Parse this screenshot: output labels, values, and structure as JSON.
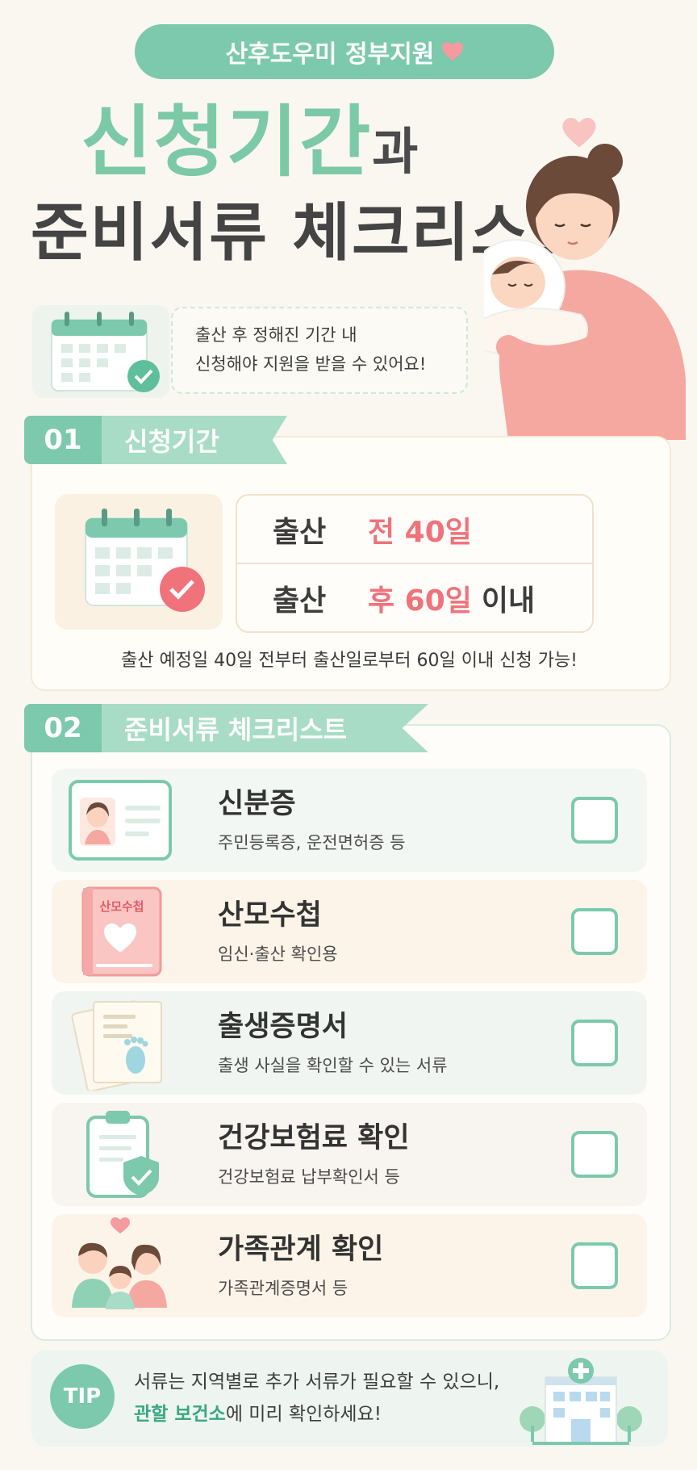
{
  "header": {
    "pill_text": "산후도우미 정부지원",
    "title_main": "신청기간",
    "title_suffix": "과",
    "title_line2": "준비서류 체크리스트"
  },
  "intro": {
    "line1": "출산 후 정해진 기간 내",
    "line2": "신청해야 지원을 받을 수 있어요!"
  },
  "section1": {
    "number": "01",
    "label": "신청기간",
    "rows": [
      {
        "label": "출산",
        "accent": "전 40일",
        "tail": ""
      },
      {
        "label": "출산",
        "accent": "후 60일",
        "tail": "이내"
      }
    ],
    "note": "출산 예정일 40일 전부터 출산일로부터 60일 이내 신청 가능!"
  },
  "section2": {
    "number": "02",
    "label": "준비서류 체크리스트",
    "items": [
      {
        "title": "신분증",
        "sub": "주민등록증, 운전면허증 등",
        "icon": "id-card-icon",
        "checked": false
      },
      {
        "title": "산모수첩",
        "sub": "임신·출산 확인용",
        "icon": "maternity-handbook-icon",
        "book_label": "산모수첩",
        "checked": false
      },
      {
        "title": "출생증명서",
        "sub": "출생 사실을 확인할 수 있는 서류",
        "icon": "birth-certificate-icon",
        "checked": false
      },
      {
        "title": "건강보험료 확인",
        "sub": "건강보험료 납부확인서 등",
        "icon": "insurance-clipboard-icon",
        "checked": false
      },
      {
        "title": "가족관계 확인",
        "sub": "가족관계증명서  등",
        "icon": "family-icon",
        "checked": false
      }
    ]
  },
  "tip": {
    "badge": "TIP",
    "line1": "서류는 지역별로 추가 서류가 필요할 수 있으니,",
    "line2_highlight": "관할 보건소",
    "line2_rest": "에 미리 확인하세요!"
  },
  "colors": {
    "mint": "#7cc9ad",
    "mint_light": "#a9dcc7",
    "accent_red": "#f0727a",
    "background": "#faf7f1"
  }
}
